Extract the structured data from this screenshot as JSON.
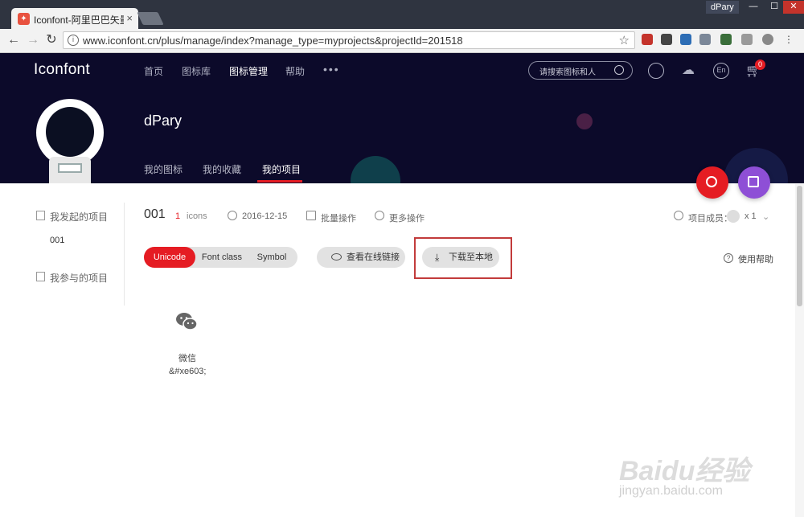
{
  "browser": {
    "tab_title": "Iconfont-阿里巴巴矢量图",
    "user_badge": "dPary",
    "url": "www.iconfont.cn/plus/manage/index?manage_type=myprojects&projectId=201518",
    "window_controls": [
      "minimize-icon",
      "maximize-icon",
      "close-icon"
    ]
  },
  "site": {
    "logo": "Iconfont",
    "nav": [
      "首页",
      "图标库",
      "图标管理",
      "帮助"
    ],
    "search_placeholder": "请搜索图标和人",
    "lang_label": "En",
    "cart_count": "0",
    "username": "dPary",
    "subtabs": [
      "我的图标",
      "我的收藏",
      "我的项目"
    ]
  },
  "sidebar": {
    "started_projects": "我发起的项目",
    "project_item": "001",
    "joined_projects": "我参与的项目"
  },
  "project": {
    "name": "001",
    "icon_count": "1",
    "icon_unit": "icons",
    "date": "2016-12-15",
    "batch_ops": "批量操作",
    "more_ops": "更多操作",
    "members_label": "项目成员：",
    "members_count": "x 1"
  },
  "toolbar": {
    "segments": [
      "Unicode",
      "Font class",
      "Symbol"
    ],
    "view_online": "查看在线链接",
    "download": "下载至本地",
    "help": "使用帮助"
  },
  "icons": [
    {
      "name": "微信",
      "code": "&#xe603;"
    }
  ],
  "watermark": {
    "line1": "Baidu经验",
    "line2": "jingyan.baidu.com"
  },
  "colors": {
    "accent_red": "#e51c23",
    "hero_bg": "#0c0a2a",
    "fab_purple": "#8e4fd6"
  }
}
